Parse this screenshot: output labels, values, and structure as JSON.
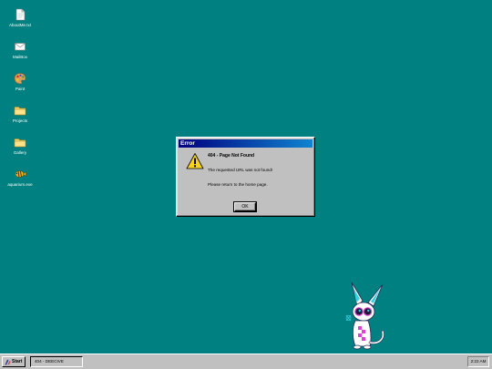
{
  "desktop": {
    "icons": [
      {
        "label": "AboutMe.txt",
        "icon": "text-file-icon"
      },
      {
        "label": "MailBox",
        "icon": "mail-icon"
      },
      {
        "label": "Paint",
        "icon": "paint-palette-icon"
      },
      {
        "label": "Projects",
        "icon": "folder-icon"
      },
      {
        "label": "Gallery",
        "icon": "folder-icon"
      },
      {
        "label": "aquarium.exe",
        "icon": "fish-icon"
      }
    ]
  },
  "dialog": {
    "title": "Error",
    "heading": "404 - Page Not Found",
    "line1": "The requested URL was not found!",
    "line2": "Please return to the home page.",
    "ok_label": "OK",
    "icon": "warning-icon"
  },
  "taskbar": {
    "start_label": "Start",
    "task_label": "404 - DEECIVE",
    "clock": "2:22 AM"
  },
  "colors": {
    "desktop": "#008080",
    "titlebar_start": "#000080",
    "titlebar_end": "#1084d0",
    "chrome": "#c0c0c0"
  }
}
